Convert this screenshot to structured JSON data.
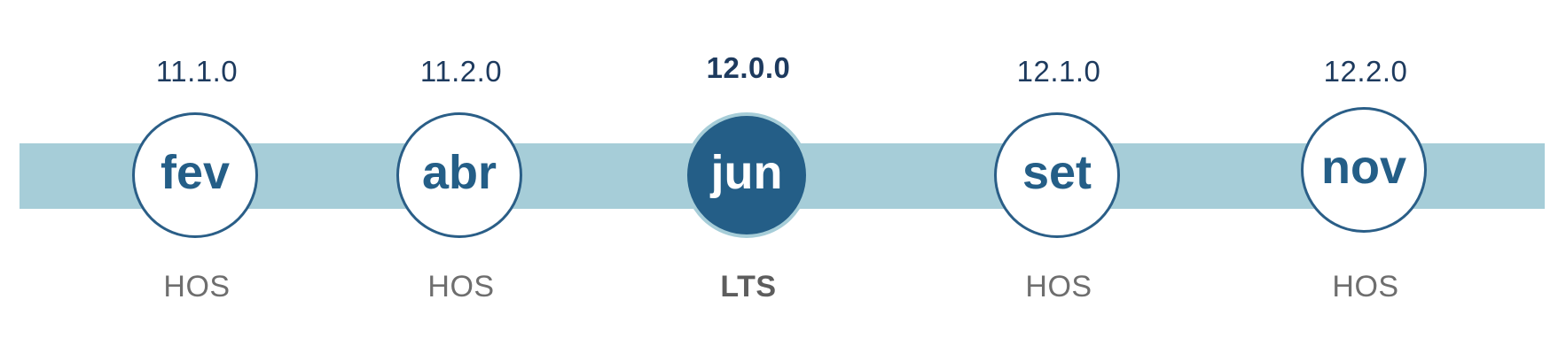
{
  "timeline": {
    "milestones": [
      {
        "month": "fev",
        "version": "11.1.0",
        "kind": "HOS",
        "current": false
      },
      {
        "month": "abr",
        "version": "11.2.0",
        "kind": "HOS",
        "current": false
      },
      {
        "month": "jun",
        "version": "12.0.0",
        "kind": "LTS",
        "current": true
      },
      {
        "month": "set",
        "version": "12.1.0",
        "kind": "HOS",
        "current": false
      },
      {
        "month": "nov",
        "version": "12.2.0",
        "kind": "HOS",
        "current": false
      }
    ]
  },
  "colors": {
    "band": "#a6cdd8",
    "circle_border": "#2a5e87",
    "circle_fill_current": "#245e87",
    "month_text": "#245e87",
    "version_text": "#1d3a5e",
    "kind_text": "#6e6e6e"
  }
}
